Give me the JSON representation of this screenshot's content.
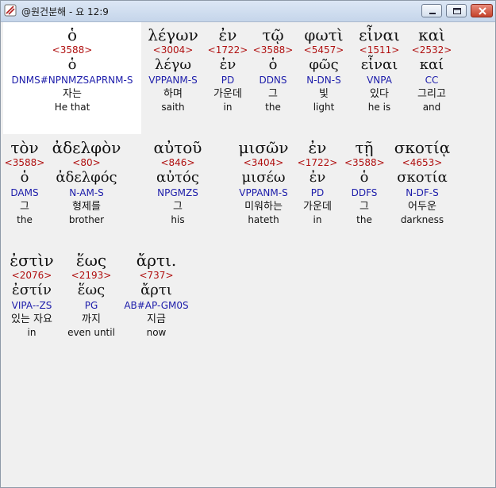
{
  "window": {
    "title": "@원건분해 - 요 12:9",
    "buttons": {
      "minimize": "minimize",
      "maximize": "maximize",
      "close": "close"
    }
  },
  "rows": [
    {
      "words": [
        {
          "greek": "ὁ",
          "strong": "<3588>",
          "lemma": "ὁ",
          "parse": "DNMS#NPNMZSAPRNM-S",
          "korean": "자는",
          "english": "He that"
        },
        {
          "greek": "λέγων",
          "strong": "<3004>",
          "lemma": "λέγω",
          "parse": "VPPANM-S",
          "korean": "하며",
          "english": "saith"
        },
        {
          "greek": "ἐν",
          "strong": "<1722>",
          "lemma": "ἐν",
          "parse": "PD",
          "korean": "가운데",
          "english": "in"
        },
        {
          "greek": "τῷ",
          "strong": "<3588>",
          "lemma": "ὁ",
          "parse": "DDNS",
          "korean": "그",
          "english": "the"
        },
        {
          "greek": "φωτὶ",
          "strong": "<5457>",
          "lemma": "φῶς",
          "parse": "N-DN-S",
          "korean": "빛",
          "english": "light"
        },
        {
          "greek": "εἶναι",
          "strong": "<1511>",
          "lemma": "εἶναι",
          "parse": "VNPA",
          "korean": "있다",
          "english": "he is"
        },
        {
          "greek": "καὶ",
          "strong": "<2532>",
          "lemma": "καί",
          "parse": "CC",
          "korean": "그리고",
          "english": "and"
        }
      ]
    },
    {
      "words": [
        {
          "greek": "τὸν",
          "strong": "<3588>",
          "lemma": "ὁ",
          "parse": "DAMS",
          "korean": "그",
          "english": "the"
        },
        {
          "greek": "ἀδελφὸν",
          "strong": "<80>",
          "lemma": "ἀδελφός",
          "parse": "N-AM-S",
          "korean": "형제를",
          "english": "brother"
        },
        {
          "greek": "αὐτοῦ",
          "strong": "<846>",
          "lemma": "αὐτός",
          "parse": "NPGMZS",
          "korean": "그",
          "english": "his"
        },
        {
          "greek": "μισῶν",
          "strong": "<3404>",
          "lemma": "μισέω",
          "parse": "VPPANM-S",
          "korean": "미워하는",
          "english": "hateth"
        },
        {
          "greek": "ἐν",
          "strong": "<1722>",
          "lemma": "ἐν",
          "parse": "PD",
          "korean": "가운데",
          "english": "in"
        },
        {
          "greek": "τῇ",
          "strong": "<3588>",
          "lemma": "ὁ",
          "parse": "DDFS",
          "korean": "그",
          "english": "the"
        },
        {
          "greek": "σκοτίᾳ",
          "strong": "<4653>",
          "lemma": "σκοτία",
          "parse": "N-DF-S",
          "korean": "어두운",
          "english": "darkness"
        }
      ]
    },
    {
      "words": [
        {
          "greek": "ἐστὶν",
          "strong": "<2076>",
          "lemma": "ἐστίν",
          "parse": "VIPA--ZS",
          "korean": "있는 자요",
          "english": "in"
        },
        {
          "greek": "ἕως",
          "strong": "<2193>",
          "lemma": "ἕως",
          "parse": "PG",
          "korean": "까지",
          "english": "even until"
        },
        {
          "greek": "ἄρτι.",
          "strong": "<737>",
          "lemma": "ἄρτι",
          "parse": "AB#AP-GM0S",
          "korean": "지금",
          "english": "now"
        }
      ]
    }
  ]
}
